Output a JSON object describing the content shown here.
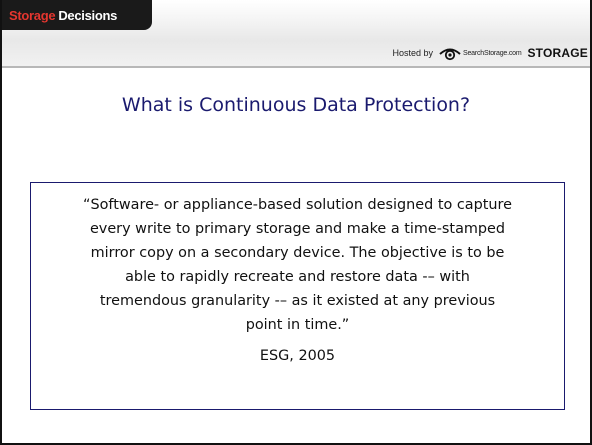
{
  "header": {
    "logo_word_1": "Storage",
    "logo_word_2": "Decisions",
    "hosted_label": "Hosted by",
    "site_label": "SearchStorage.com",
    "brand_label": "STORAGE",
    "icon": "eye-icon",
    "logo_colors": {
      "storage": "#e5362f",
      "decisions": "#ffffff",
      "tab": "#1a1a1a"
    }
  },
  "slide": {
    "title": "What is Continuous Data Protection?",
    "quote": "“Software- or appliance-based solution designed to capture\nevery write to primary storage and make a time-stamped\nmirror copy on a secondary device. The objective is to be\nable to rapidly recreate and restore data -– with\ntremendous granularity -– as it existed at any previous\npoint in time.”",
    "attribution": "ESG, 2005",
    "title_color": "#1a1a6e",
    "box_border_color": "#1a1a6e"
  }
}
